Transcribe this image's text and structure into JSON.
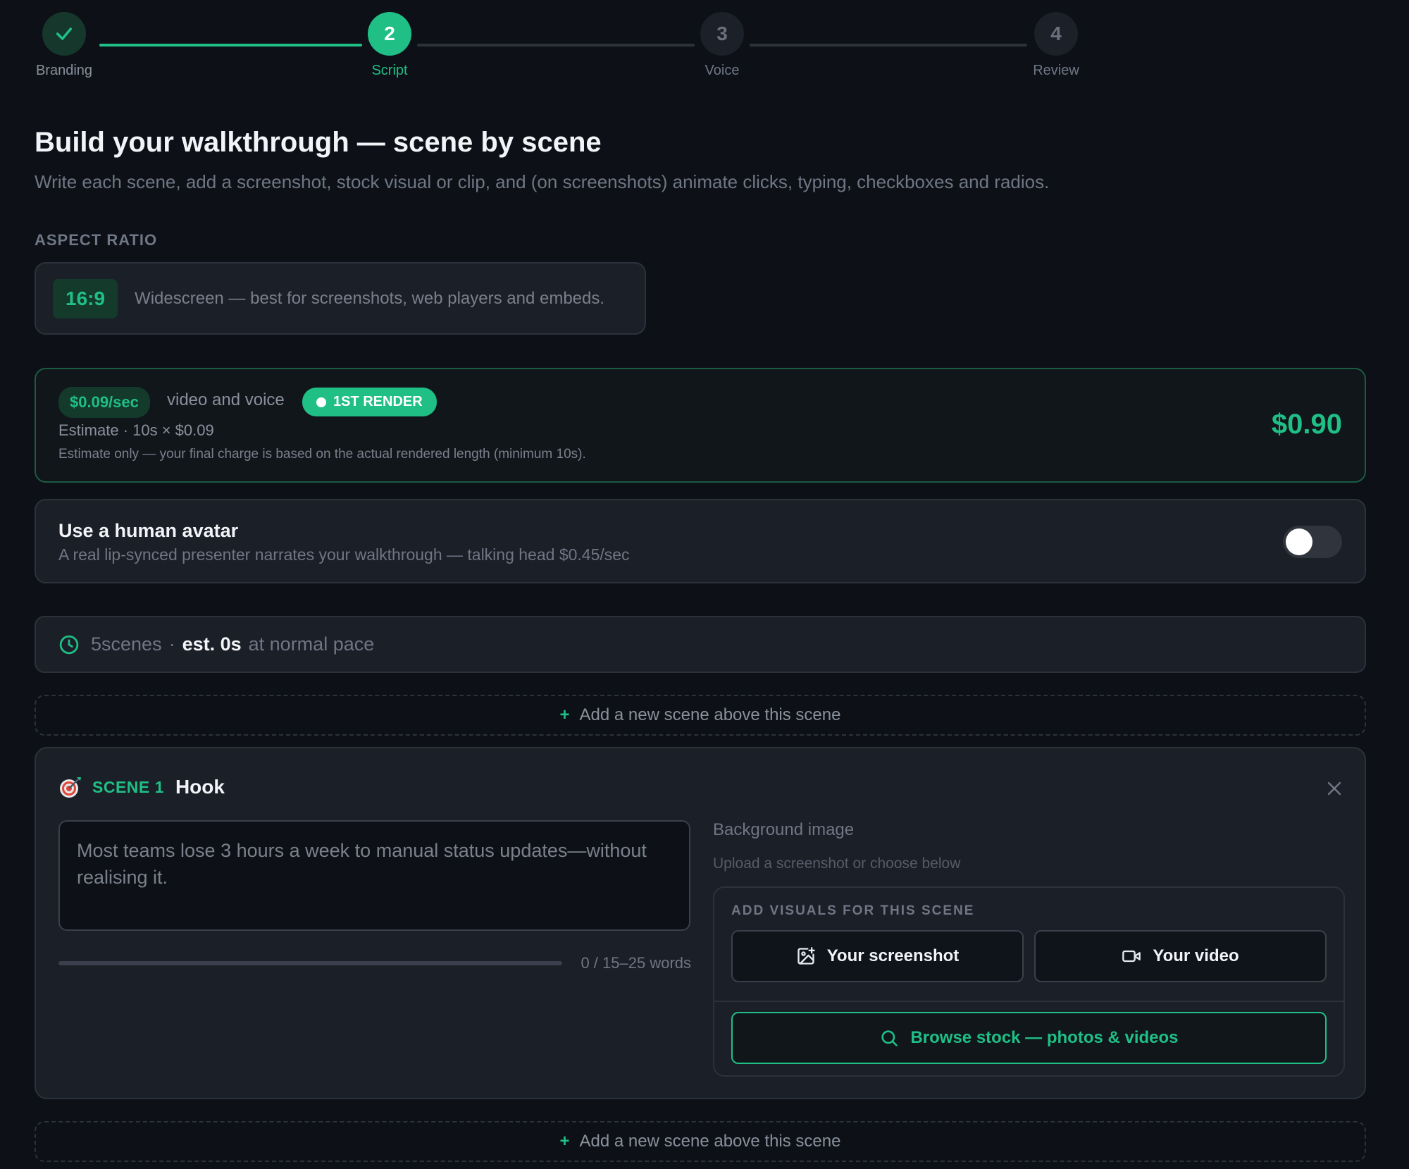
{
  "stepper": {
    "steps": [
      {
        "label": "Branding",
        "number": "✓",
        "state": "done"
      },
      {
        "label": "Script",
        "number": "2",
        "state": "active"
      },
      {
        "label": "Voice",
        "number": "3",
        "state": "todo"
      },
      {
        "label": "Review",
        "number": "4",
        "state": "todo"
      }
    ]
  },
  "header": {
    "title": "Build your walkthrough — scene by scene",
    "subtitle": "Write each scene, add a screenshot, stock visual or clip, and (on screenshots) animate clicks, typing, checkboxes and radios."
  },
  "aspect": {
    "section_label": "ASPECT RATIO",
    "ratio": "16:9",
    "description": "Widescreen — best for screenshots, web players and embeds."
  },
  "pricing": {
    "rate": "$0.09/sec",
    "rate_desc": "video and voice",
    "badge": "1ST RENDER",
    "estimate": "Estimate · 10s × $0.09",
    "note": "Estimate only — your final charge is based on the actual rendered length (minimum 10s).",
    "total": "$0.90"
  },
  "avatar": {
    "title": "Use a human avatar",
    "description": "A real lip-synced presenter narrates your walkthrough — talking head $0.45/sec",
    "enabled": false
  },
  "summary": {
    "scenes": "5scenes",
    "separator": "·",
    "estimate": "est. 0s",
    "pace": "at normal pace"
  },
  "add_scene": {
    "plus": "+",
    "label": "Add a new scene above this scene"
  },
  "scene": {
    "number_label": "SCENE 1",
    "name": "Hook",
    "script_placeholder": "Most teams lose 3 hours a week to manual status updates—without realising it.",
    "word_count": "0 / 15–25 words",
    "word_progress": 0,
    "bg_title": "Background image",
    "bg_sub": "Upload a screenshot or choose below",
    "visuals_heading": "ADD VISUALS FOR THIS SCENE",
    "screenshot_btn": "Your screenshot",
    "video_btn": "Your video",
    "stock_btn": "Browse stock — photos & videos"
  },
  "colors": {
    "accent": "#1fbf86",
    "background": "#0d1117",
    "card": "#1b1f27"
  },
  "icons": {
    "step_done": "check-icon",
    "summary": "clock-icon",
    "scene": "target-emoji-icon",
    "close": "close-icon",
    "screenshot": "image-add-icon",
    "video": "video-camera-icon",
    "stock": "search-icon"
  }
}
